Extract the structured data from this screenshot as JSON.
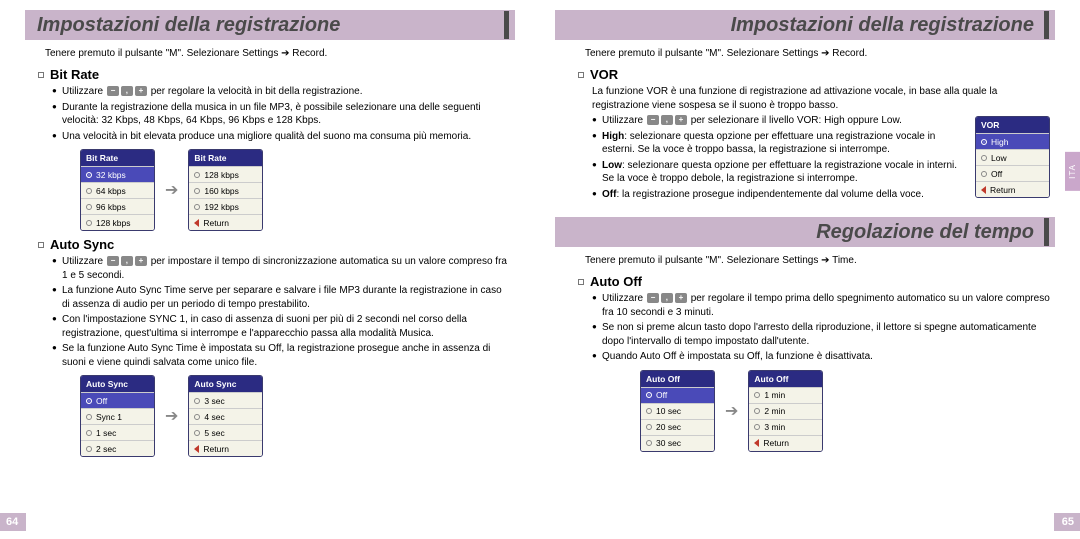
{
  "left": {
    "header": "Impostazioni della registrazione",
    "intro": "Tenere premuto il pulsante \"M\". Selezionare Settings ➔ Record.",
    "bitrate": {
      "title": "Bit Rate",
      "b1_pre": "Utilizzare ",
      "b1_post": " per regolare la velocità in bit della registrazione.",
      "b2": "Durante la registrazione della musica in un file MP3, è possibile selezionare una delle seguenti velocità: 32 Kbps, 48 Kbps, 64 Kbps, 96 Kbps e 128 Kbps.",
      "b3": "Una velocità in bit elevata produce una migliore qualità del suono ma consuma più memoria.",
      "menu1": {
        "title": "Bit Rate",
        "items": [
          "32 kbps",
          "64 kbps",
          "96 kbps",
          "128 kbps"
        ],
        "sel": 0
      },
      "menu2": {
        "title": "Bit Rate",
        "items": [
          "128 kbps",
          "160 kbps",
          "192 kbps",
          "Return"
        ],
        "sel": 0
      }
    },
    "autosync": {
      "title": "Auto Sync",
      "b1_pre": "Utilizzare ",
      "b1_post": " per impostare il tempo di sincronizzazione automatica su un valore compreso fra 1 e 5 secondi.",
      "b2": "La funzione Auto Sync Time serve per separare e salvare i file MP3 durante la registrazione in caso di assenza di audio per un periodo di tempo prestabilito.",
      "b3": "Con l'impostazione SYNC 1, in caso di assenza di suoni per più di 2 secondi nel corso della registrazione, quest'ultima si interrompe e l'apparecchio passa alla modalità Musica.",
      "b4": "Se la funzione Auto Sync Time è impostata su Off, la registrazione prosegue anche in assenza di suoni e viene quindi salvata come unico file.",
      "menu1": {
        "title": "Auto Sync",
        "items": [
          "Off",
          "Sync 1",
          "1 sec",
          "2 sec"
        ],
        "sel": 0
      },
      "menu2": {
        "title": "Auto Sync",
        "items": [
          "3 sec",
          "4 sec",
          "5 sec",
          "Return"
        ],
        "sel": -1
      }
    },
    "page_num": "64"
  },
  "right": {
    "header1": "Impostazioni della registrazione",
    "intro1": "Tenere premuto il pulsante \"M\". Selezionare Settings ➔ Record.",
    "vor": {
      "title": "VOR",
      "desc": "La funzione VOR è una funzione di registrazione ad attivazione vocale, in base alla quale la registrazione viene sospesa se il suono è troppo basso.",
      "b1_pre": "Utilizzare ",
      "b1_post": " per selezionare il livello VOR: High oppure Low.",
      "b2_label": "High",
      "b2_text": ": selezionare questa opzione per effettuare una registrazione vocale in esterni. Se la voce è troppo bassa, la registrazione si interrompe.",
      "b3_label": "Low",
      "b3_text": ": selezionare questa opzione per effettuare la registrazione vocale in interni. Se la voce è troppo debole, la registrazione si interrompe.",
      "b4_label": "Off",
      "b4_text": ": la registrazione prosegue indipendentemente dal volume della voce.",
      "menu": {
        "title": "VOR",
        "items": [
          "High",
          "Low",
          "Off",
          "Return"
        ],
        "sel": 0
      }
    },
    "header2": "Regolazione del tempo",
    "intro2": "Tenere premuto il pulsante \"M\". Selezionare Settings ➔ Time.",
    "autooff": {
      "title": "Auto Off",
      "b1_pre": "Utilizzare ",
      "b1_post": " per regolare il tempo prima dello spegnimento automatico su un valore compreso fra 10 secondi e 3 minuti.",
      "b2": "Se non si preme alcun tasto dopo l'arresto della riproduzione, il lettore si spegne automaticamente dopo l'intervallo di tempo impostato dall'utente.",
      "b3": "Quando Auto Off è impostata su Off, la funzione è disattivata.",
      "menu1": {
        "title": "Auto Off",
        "items": [
          "Off",
          "10 sec",
          "20 sec",
          "30 sec"
        ],
        "sel": 0
      },
      "menu2": {
        "title": "Auto Off",
        "items": [
          "1 min",
          "2 min",
          "3 min",
          "Return"
        ],
        "sel": -1
      }
    },
    "side_tab": "ITA",
    "page_num": "65"
  },
  "ui": {
    "return_label": "Return"
  }
}
